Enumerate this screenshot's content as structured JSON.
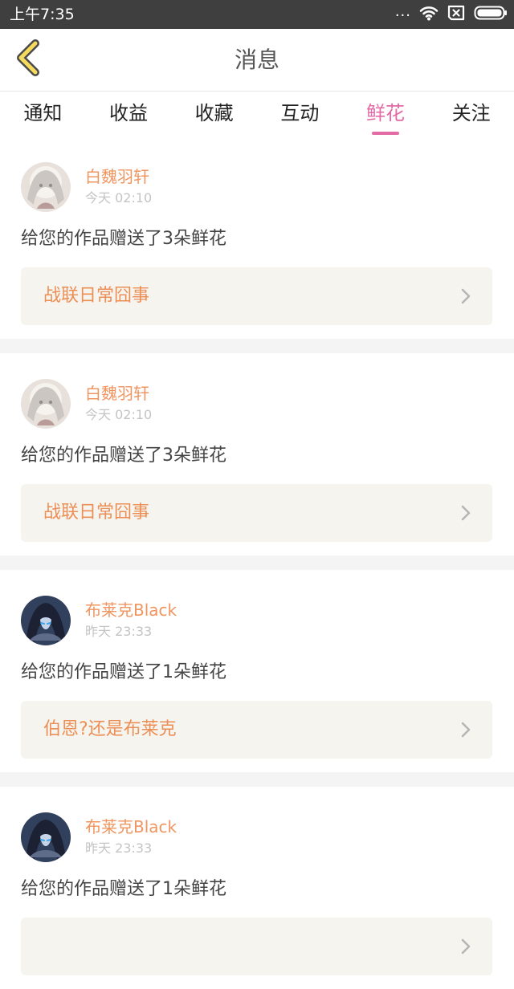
{
  "status_bar": {
    "time": "上午7:35",
    "dots": "...",
    "icons": [
      "wifi-icon",
      "sim-x-icon",
      "battery-icon"
    ]
  },
  "header": {
    "title": "消息",
    "back_icon": "back-chevron-icon"
  },
  "tabs": [
    {
      "label": "通知",
      "active": false
    },
    {
      "label": "收益",
      "active": false
    },
    {
      "label": "收藏",
      "active": false
    },
    {
      "label": "互动",
      "active": false
    },
    {
      "label": "鲜花",
      "active": true
    },
    {
      "label": "关注",
      "active": false
    }
  ],
  "messages": [
    {
      "user": "白魏羽轩",
      "time": "今天 02:10",
      "text": "给您的作品赠送了3朵鲜花",
      "work": "战联日常囧事",
      "avatar": "avatar-white-hair"
    },
    {
      "user": "白魏羽轩",
      "time": "今天 02:10",
      "text": "给您的作品赠送了3朵鲜花",
      "work": "战联日常囧事",
      "avatar": "avatar-white-hair"
    },
    {
      "user": "布莱克Black",
      "time": "昨天 23:33",
      "text": "给您的作品赠送了1朵鲜花",
      "work": "伯恩?还是布莱克",
      "avatar": "avatar-dark-hood"
    },
    {
      "user": "布莱克Black",
      "time": "昨天 23:33",
      "text": "给您的作品赠送了1朵鲜花",
      "work": "",
      "avatar": "avatar-dark-hood"
    }
  ],
  "colors": {
    "status_bar": "#3f3f3f",
    "accent_pink": "#e36aa5",
    "name_orange": "#f0955f",
    "work_orange": "#ec8f57",
    "time_gray": "#c4c4c4",
    "card_gray": "#f5f4ee",
    "back_icon_yellow": "#f6da5d"
  }
}
